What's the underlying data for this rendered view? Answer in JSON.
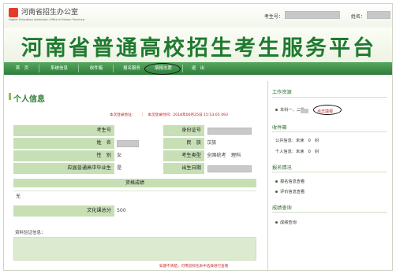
{
  "header": {
    "org_title": "河南省招生办公室",
    "org_subtitle": "Higher Education Admission Office of Henan Province",
    "student_no_label": "考生号：",
    "name_label": "姓名："
  },
  "banner": {
    "title": "河南省普通高校招生考生服务平台"
  },
  "nav": {
    "items": [
      {
        "label": "首　页"
      },
      {
        "label": "系统信息"
      },
      {
        "label": "收件箱"
      },
      {
        "label": "报名服务"
      },
      {
        "label": "填报志愿"
      },
      {
        "label": "退　出"
      }
    ]
  },
  "main": {
    "section_title": "个人信息",
    "login_info": "本次登录地址：　　｜　本次登录时间：2018年06月25日 15:53:05 493",
    "fields": {
      "student_no": "考生号",
      "id_no": "身份证号",
      "name": "姓　名",
      "ethnicity": "民　族",
      "ethnicity_value": "汉族",
      "gender": "性　别",
      "gender_value": "女",
      "exam_type": "考生类型",
      "exam_type_value": "全国统考　理科",
      "graduate": "应届普通高中毕业生",
      "graduate_value": "是",
      "birth": "出生日期"
    },
    "qualification_header": "资格成绩",
    "qualification_value": "无",
    "culture_score_label": "文化课总分",
    "culture_score_value": "500",
    "verify_label": "资料验证信息：",
    "footer_note": "如遇不清楚，可用鼠标在表中选择进行查看"
  },
  "sidebar": {
    "work_heading": "工作资源",
    "batch_item": "本科一、二批",
    "batch_link": "点击填报",
    "inbox_heading": "收件箱",
    "public_msg": "公共信息：未读　0　封",
    "private_msg": "个人信息：未读　0　封",
    "signup_heading": "报名情况",
    "signup_items": [
      "报名信息查看",
      "评价信息查看"
    ],
    "score_heading": "成绩查询",
    "score_items": [
      "成绩查询"
    ]
  }
}
